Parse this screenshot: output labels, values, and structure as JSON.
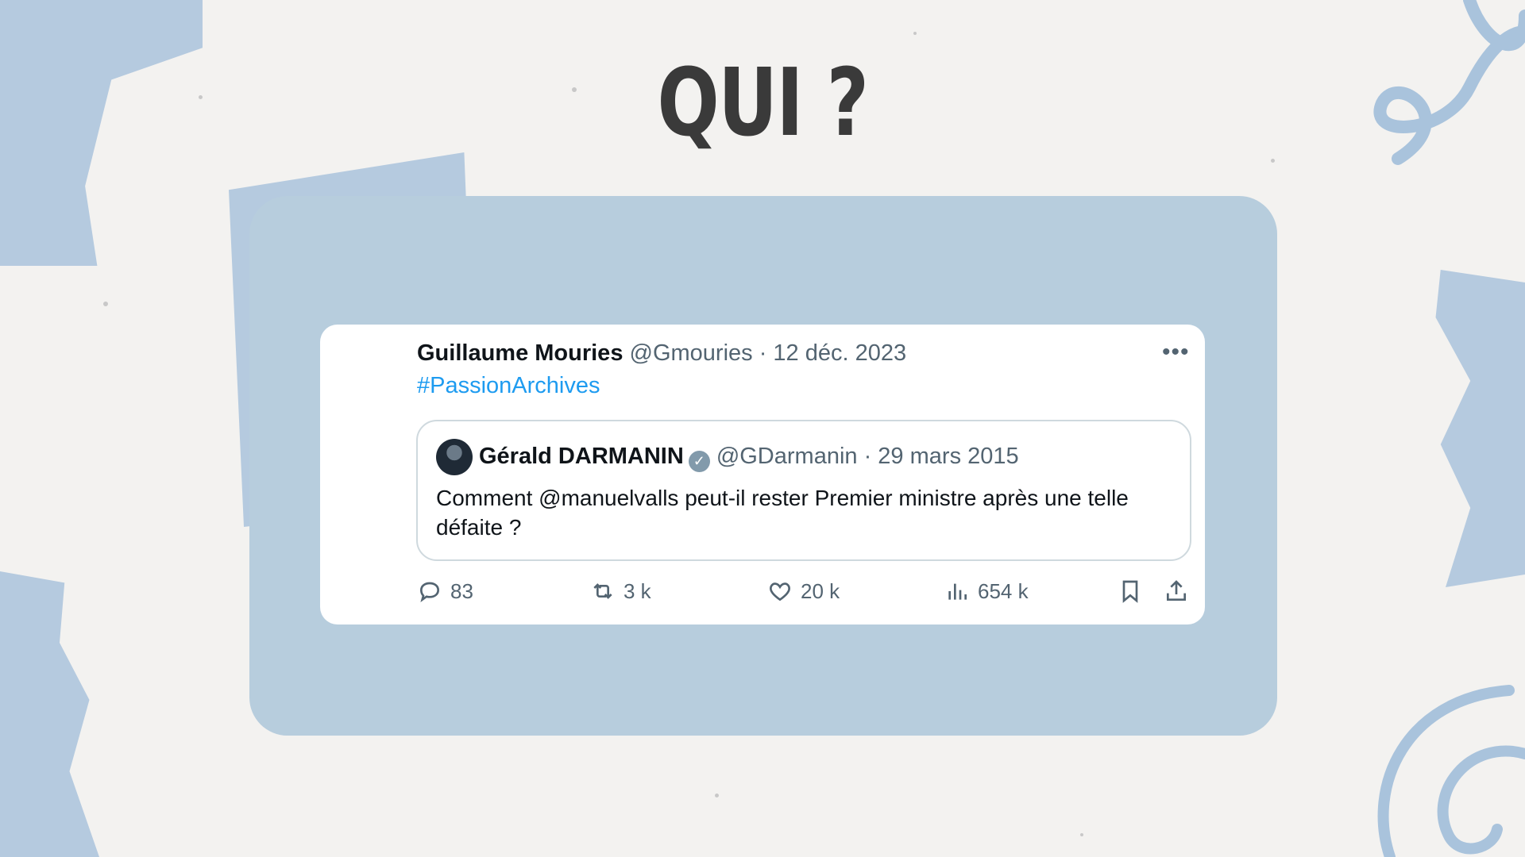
{
  "slide": {
    "title": "QUI ?"
  },
  "tweet": {
    "author": "Guillaume Mouries",
    "handle": "@Gmouries",
    "date": "· 12 déc. 2023",
    "hashtag": "#PassionArchives",
    "more_icon": "more-icon",
    "quoted": {
      "name": "Gérald DARMANIN",
      "handle": "@GDarmanin",
      "date": "· 29 mars 2015",
      "text": "Comment @manuelvalls peut-il rester Premier ministre après une telle défaite ?"
    },
    "actions": {
      "replies": "83",
      "retweets": "3 k",
      "likes": "20 k",
      "views": "654 k"
    }
  },
  "colors": {
    "background": "#f3f2f0",
    "panel": "#b7cddd",
    "watercolor": "#a9c3dc",
    "link": "#1d9bf0",
    "text": "#0f1419",
    "muted": "#536471"
  }
}
